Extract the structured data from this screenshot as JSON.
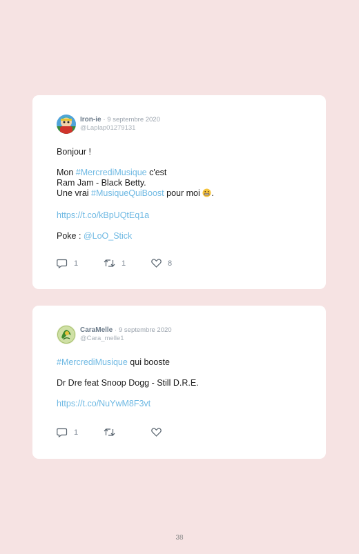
{
  "tweets": [
    {
      "username": "Iron-ie",
      "separator": "·",
      "date": "9 septembre 2020",
      "handle": "@Laplap01279131",
      "body": {
        "greeting": "Bonjour !",
        "l1_pre": "Mon ",
        "l1_tag": "#MercrediMusique",
        "l1_post": " c'est",
        "l2": "Ram Jam - Black Betty.",
        "l3_pre": "Une vrai ",
        "l3_tag": "#MusiqueQuiBoost",
        "l3_post": " pour moi ",
        "l3_end": ".",
        "url": "https://t.co/kBpUQtEq1a",
        "poke_pre": "Poke : ",
        "poke_mention": "@LoO_Stick"
      },
      "replies": "1",
      "retweets": "1",
      "likes": "8"
    },
    {
      "username": "CaraMelle",
      "separator": "·",
      "date": "9 septembre 2020",
      "handle": "@Cara_melle1",
      "body": {
        "l1_tag": "#MercrediMusique",
        "l1_post": " qui booste",
        "l2": "Dr Dre feat Snoop Dogg - Still D.R.E.",
        "url": "https://t.co/NuYwM8F3vt"
      },
      "replies": "1",
      "retweets": "",
      "likes": ""
    }
  ],
  "page_number": "38",
  "icons": {
    "reply": "reply-icon",
    "retweet": "retweet-icon",
    "like": "heart-icon",
    "emoji": "grimacing-face-emoji"
  },
  "colors": {
    "background": "#f6e3e3",
    "link": "#6fb9e3",
    "username": "#6b7a89"
  }
}
